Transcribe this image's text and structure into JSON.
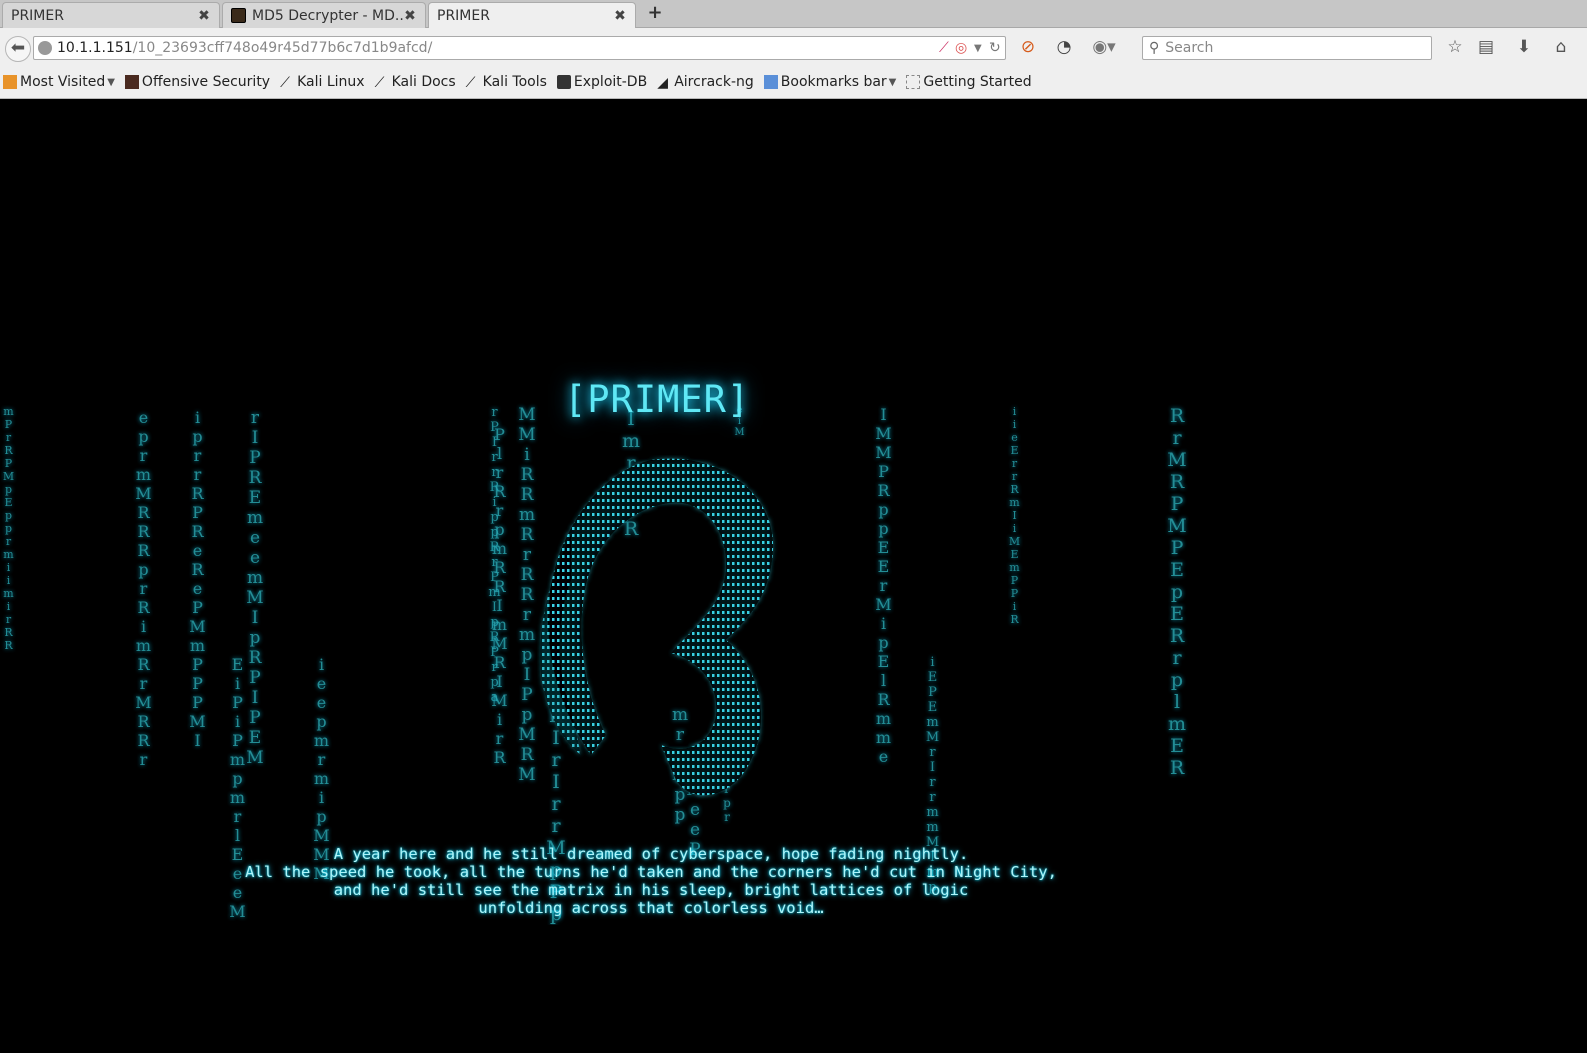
{
  "tabs": [
    {
      "title": "PRIMER",
      "close": "✖"
    },
    {
      "title": "MD5 Decrypter - MD...",
      "close": "✖"
    },
    {
      "title": "PRIMER",
      "close": "✖"
    }
  ],
  "new_tab": "+",
  "url": {
    "host": "10.1.1.151",
    "path": "/10_23693cff748o49r45d77b6c7d1b9afcd/"
  },
  "search": {
    "placeholder": "Search"
  },
  "bookmarks": [
    {
      "label": "Most Visited",
      "dropdown": true
    },
    {
      "label": "Offensive Security"
    },
    {
      "label": "Kali Linux"
    },
    {
      "label": "Kali Docs"
    },
    {
      "label": "Kali Tools"
    },
    {
      "label": "Exploit-DB"
    },
    {
      "label": "Aircrack-ng"
    },
    {
      "label": "Bookmarks bar",
      "dropdown": true
    },
    {
      "label": "Getting Started"
    }
  ],
  "page": {
    "title": "[PRIMER]",
    "story": [
      "A year here and he still dreamed of cyberspace, hope fading nightly.",
      "All the speed he took, all the turns he'd taken and the corners he'd cut in Night City,",
      "and he'd still see the matrix in his sleep, bright lattices of logic",
      "unfolding across that colorless void…"
    ]
  },
  "colors": {
    "matrix": "#2aa6b0",
    "glow": "#5fe8f5",
    "background": "#000000"
  }
}
